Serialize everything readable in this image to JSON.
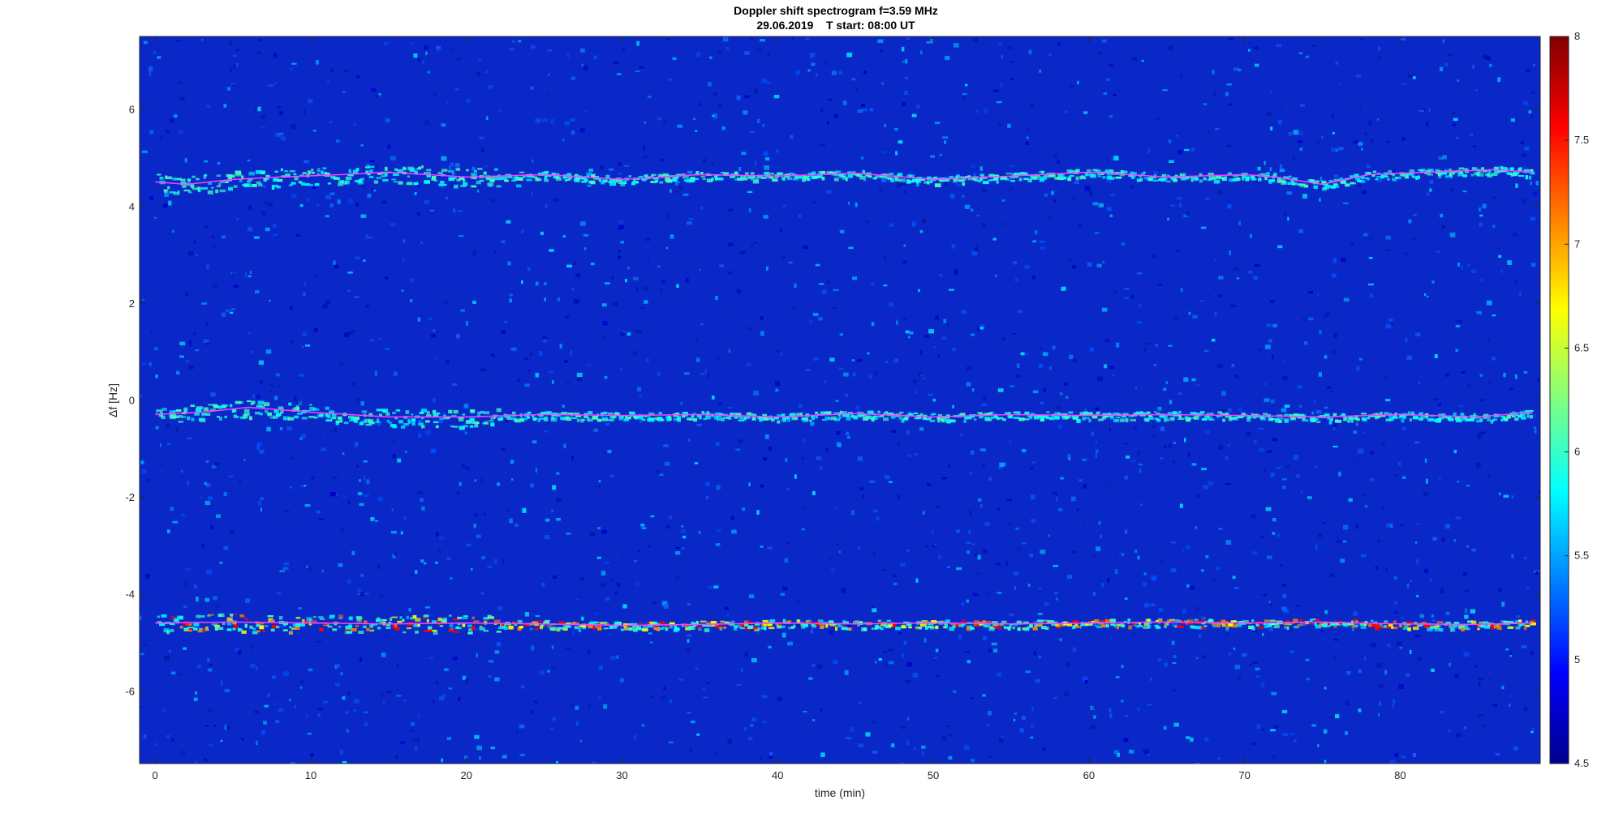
{
  "chart_data": {
    "type": "heatmap",
    "title": "Doppler shift spectrogram f=3.59 MHz",
    "subtitle": "29.06.2019    T start: 08:00 UT",
    "xlabel": "time (min)",
    "ylabel": "Δf [Hz]",
    "xlim": [
      -1,
      89
    ],
    "ylim": [
      -7.5,
      7.5
    ],
    "x_ticks": [
      0,
      10,
      20,
      30,
      40,
      50,
      60,
      70,
      80
    ],
    "y_ticks": [
      6,
      4,
      2,
      0,
      -2,
      -4,
      -6
    ],
    "colorbar": {
      "colormap": "jet",
      "range": [
        4.5,
        8
      ],
      "ticks": [
        8,
        7.5,
        7,
        6.5,
        6,
        5.5,
        5,
        4.5
      ]
    },
    "series": [
      {
        "x": [
          0,
          2,
          5,
          8,
          12,
          15,
          20,
          25,
          30,
          35,
          40,
          45,
          50,
          55,
          60,
          65,
          70,
          72,
          75,
          78,
          82,
          86,
          88.5
        ],
        "values": [
          4.5,
          4.45,
          4.55,
          4.6,
          4.65,
          4.7,
          4.6,
          4.65,
          4.55,
          4.65,
          4.62,
          4.68,
          4.55,
          4.62,
          4.7,
          4.6,
          4.65,
          4.6,
          4.45,
          4.65,
          4.7,
          4.75,
          4.7
        ]
      },
      {
        "x": [
          0,
          3,
          6,
          10,
          15,
          20,
          25,
          30,
          35,
          40,
          45,
          50,
          55,
          60,
          65,
          70,
          75,
          80,
          85,
          88.5
        ],
        "values": [
          -0.3,
          -0.25,
          -0.15,
          -0.25,
          -0.35,
          -0.35,
          -0.3,
          -0.32,
          -0.3,
          -0.35,
          -0.28,
          -0.35,
          -0.3,
          -0.32,
          -0.3,
          -0.32,
          -0.35,
          -0.3,
          -0.35,
          -0.25
        ]
      },
      {
        "x": [
          0,
          5,
          10,
          15,
          20,
          25,
          30,
          35,
          40,
          45,
          50,
          55,
          60,
          65,
          70,
          75,
          80,
          85,
          88.5
        ],
        "values": [
          -4.6,
          -4.58,
          -4.6,
          -4.62,
          -4.6,
          -4.62,
          -4.65,
          -4.63,
          -4.6,
          -4.62,
          -4.6,
          -4.62,
          -4.6,
          -4.58,
          -4.6,
          -4.58,
          -4.62,
          -4.63,
          -4.6
        ]
      }
    ]
  }
}
